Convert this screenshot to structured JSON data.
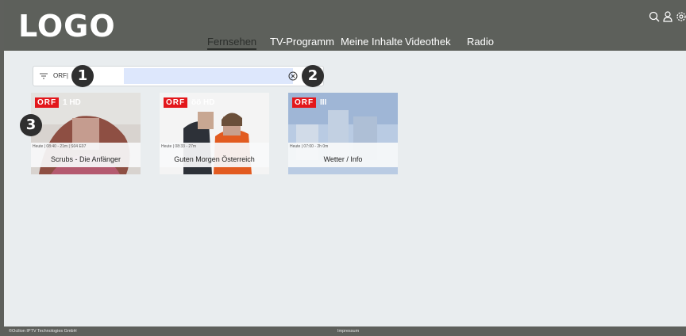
{
  "header": {
    "logo": "LOGO",
    "nav": [
      {
        "label": "Fernsehen",
        "active": true
      },
      {
        "label": "TV-Programm",
        "active": false
      },
      {
        "label": "Meine Inhalte",
        "active": false
      },
      {
        "label": "Videothek",
        "active": false
      },
      {
        "label": "Radio",
        "active": false
      }
    ],
    "icons": [
      "search-icon",
      "user-icon",
      "settings-icon"
    ]
  },
  "search": {
    "value": "ORF|",
    "icons": [
      "filter-icon",
      "clear-icon"
    ]
  },
  "markers": [
    "1",
    "2",
    "3"
  ],
  "results": [
    {
      "channel": "ORF",
      "channel_suffix": "1 HD",
      "meta": "Heute | 08:40 - 21m | S04 E07",
      "title": "Scrubs - Die Anfänger"
    },
    {
      "channel": "ORF",
      "channel_suffix": "öö HD",
      "meta": "Heute | 08:33 - 27m",
      "title": "Guten Morgen Österreich"
    },
    {
      "channel": "ORF",
      "channel_suffix": "III",
      "meta": "Heute | 07:00 - 2h 0m",
      "title": "Wetter / Info"
    }
  ],
  "footer": {
    "copyright": "©Ocilion IPTV Technologies GmbH",
    "imprint": "Impressum"
  },
  "colors": {
    "header_bg": "#5d605b",
    "page_bg": "#e9edef",
    "orf_red": "#e3171b",
    "search_highlight": "#dde7fc"
  }
}
